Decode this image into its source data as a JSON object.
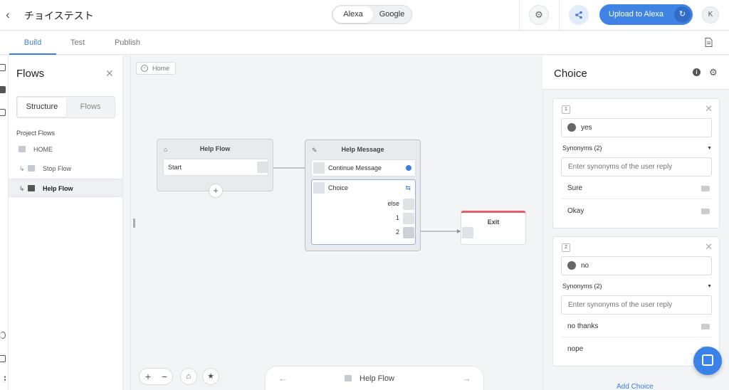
{
  "header": {
    "back_icon": "chevron-left-icon",
    "title": "チョイステスト",
    "platforms": [
      "Alexa",
      "Google"
    ],
    "selected_platform": "Alexa",
    "settings_icon": "gear-icon",
    "share_icon": "share-icon",
    "upload_label": "Upload to Alexa",
    "upload_icon": "sync-icon",
    "avatar_initial": "K"
  },
  "tabs": {
    "items": [
      "Build",
      "Test",
      "Publish"
    ],
    "active": "Build",
    "doc_icon": "document-icon"
  },
  "flows_panel": {
    "title": "Flows",
    "close_icon": "close-icon",
    "segments": [
      "Structure",
      "Flows"
    ],
    "active_segment": "Structure",
    "section_label": "Project Flows",
    "tree": [
      {
        "label": "HOME",
        "child": false
      },
      {
        "label": "Stop Flow",
        "child": true
      },
      {
        "label": "Help Flow",
        "child": true,
        "selected": true
      }
    ]
  },
  "canvas": {
    "breadcrumb": "Home",
    "nodes": {
      "help_flow": {
        "title": "Help Flow",
        "row": "Start"
      },
      "help_message": {
        "title": "Help Message",
        "continue_row": "Continue Message",
        "choice_row": "Choice",
        "paths": [
          "else",
          "1",
          "2"
        ]
      },
      "exit": {
        "title": "Exit"
      }
    },
    "nav_label": "Help Flow"
  },
  "inspector": {
    "title": "Choice",
    "choices": [
      {
        "index": "1",
        "value": "yes",
        "synonyms_label": "Synonyms (2)",
        "synonym_placeholder": "Enter synonyms of the user reply",
        "synonyms": [
          "Sure",
          "Okay"
        ]
      },
      {
        "index": "2",
        "value": "no",
        "synonyms_label": "Synonyms (2)",
        "synonym_placeholder": "Enter synonyms of the user reply",
        "synonyms": [
          "no thanks",
          "nope"
        ]
      }
    ],
    "add_choice_label": "Add Choice"
  },
  "colors": {
    "accent": "#3f84e5",
    "exit_bar": "#e55c6a"
  }
}
